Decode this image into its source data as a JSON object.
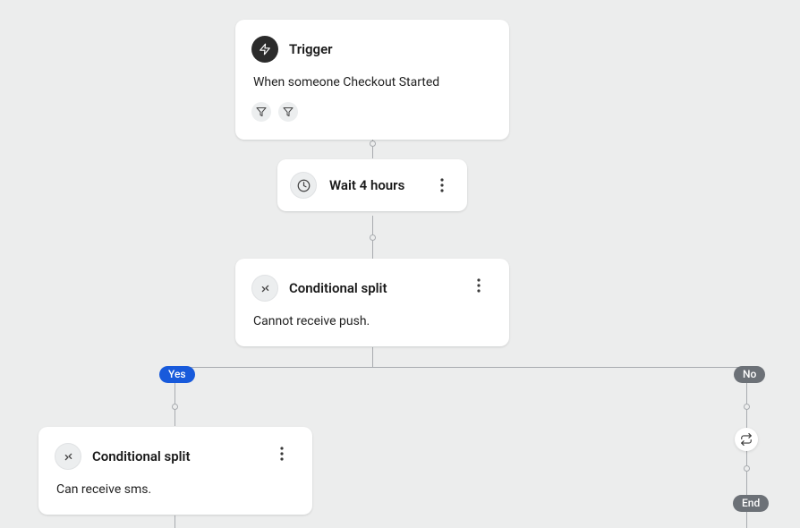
{
  "nodes": {
    "trigger": {
      "title": "Trigger",
      "description": "When someone Checkout Started"
    },
    "wait": {
      "title": "Wait 4 hours"
    },
    "split_push": {
      "title": "Conditional split",
      "description": "Cannot receive push."
    },
    "split_sms": {
      "title": "Conditional split",
      "description": "Can receive sms."
    }
  },
  "branches": {
    "yes": "Yes",
    "no": "No",
    "end": "End"
  }
}
